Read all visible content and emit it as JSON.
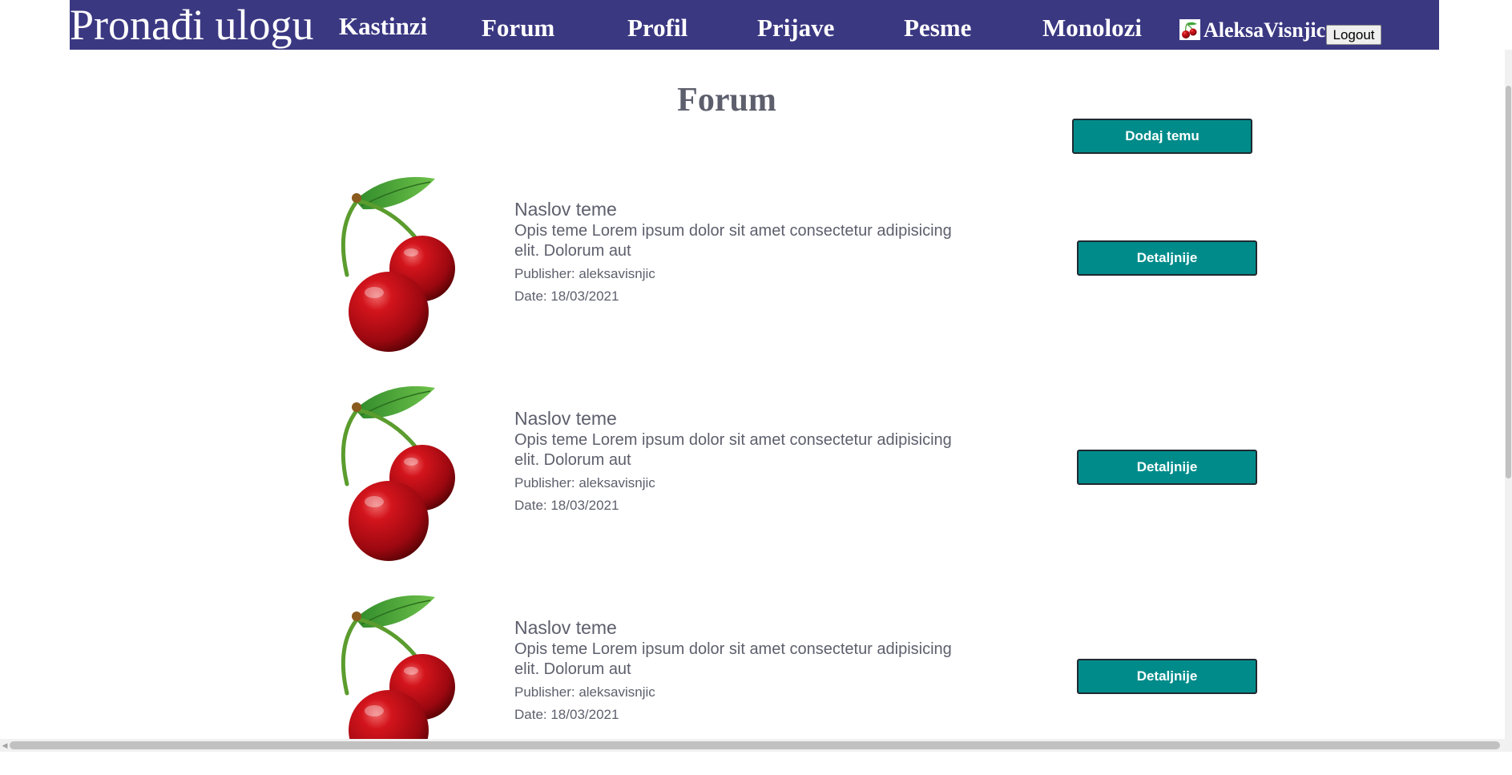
{
  "nav": {
    "brand": "Pronađi ulogu",
    "links": [
      "Kastinzi",
      "Forum",
      "Profil",
      "Prijave",
      "Pesme",
      "Monolozi"
    ],
    "username": "AleksaVisnjic",
    "logout_label": "Logout"
  },
  "page": {
    "title": "Forum",
    "add_topic_label": "Dodaj temu"
  },
  "topics": [
    {
      "title": "Naslov teme",
      "description": "Opis teme Lorem ipsum dolor sit amet consectetur adipisicing elit. Dolorum aut",
      "publisher": "Publisher: aleksavisnjic",
      "date": "Date: 18/03/2021",
      "button_label": "Detaljnije",
      "image_icon": "cherries-icon"
    },
    {
      "title": "Naslov teme",
      "description": "Opis teme Lorem ipsum dolor sit amet consectetur adipisicing elit. Dolorum aut",
      "publisher": "Publisher: aleksavisnjic",
      "date": "Date: 18/03/2021",
      "button_label": "Detaljnije",
      "image_icon": "cherries-icon"
    },
    {
      "title": "Naslov teme",
      "description": "Opis teme Lorem ipsum dolor sit amet consectetur adipisicing elit. Dolorum aut",
      "publisher": "Publisher: aleksavisnjic",
      "date": "Date: 18/03/2021",
      "button_label": "Detaljnije",
      "image_icon": "cherries-icon"
    }
  ],
  "colors": {
    "navbar": "#3b3882",
    "button": "#008b8b",
    "text": "#5d5f6c"
  }
}
